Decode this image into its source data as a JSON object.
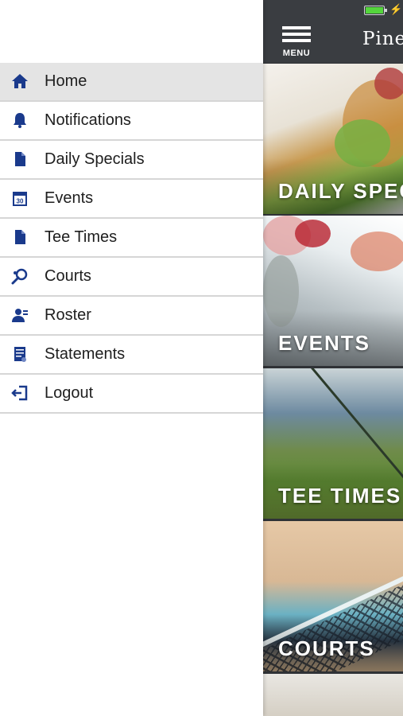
{
  "status_bar": {
    "battery_level": 1.0,
    "charging_glyph": "⚡"
  },
  "header": {
    "menu_label": "MENU",
    "club_name": "Pine"
  },
  "tiles": [
    {
      "label": "DAILY SPEC"
    },
    {
      "label": "EVENTS"
    },
    {
      "label": "TEE TIMES"
    },
    {
      "label": "COURTS"
    }
  ],
  "drawer": {
    "items": [
      {
        "label": "Home",
        "icon": "home-icon",
        "active": true
      },
      {
        "label": "Notifications",
        "icon": "bell-icon",
        "active": false
      },
      {
        "label": "Daily Specials",
        "icon": "document-icon",
        "active": false
      },
      {
        "label": "Events",
        "icon": "calendar-icon",
        "active": false,
        "icon_text": "30"
      },
      {
        "label": "Tee Times",
        "icon": "document-icon",
        "active": false
      },
      {
        "label": "Courts",
        "icon": "tennis-racket-icon",
        "active": false
      },
      {
        "label": "Roster",
        "icon": "person-icon",
        "active": false
      },
      {
        "label": "Statements",
        "icon": "statement-icon",
        "active": false
      },
      {
        "label": "Logout",
        "icon": "logout-icon",
        "active": false
      }
    ]
  },
  "colors": {
    "icon_blue": "#1a3a8c",
    "header_bg": "#3a3d41",
    "active_row": "#e4e4e4",
    "divider": "#d6d6d6"
  }
}
